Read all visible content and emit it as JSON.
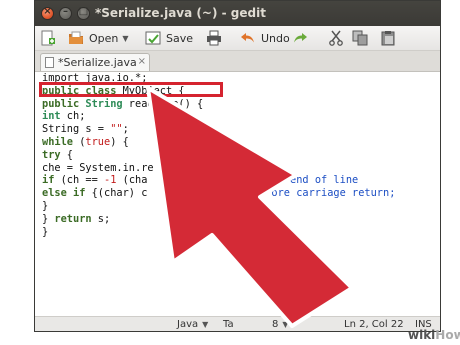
{
  "window": {
    "title": "*Serialize.java (~) - gedit",
    "controls": {
      "close": "×",
      "minimize": "–",
      "maximize": "□"
    }
  },
  "toolbar": {
    "open_label": "Open",
    "save_label": "Save",
    "undo_label": "Undo",
    "icons": [
      "new-document-icon",
      "open-folder-icon",
      "save-icon",
      "print-icon",
      "undo-icon",
      "redo-icon",
      "cut-icon",
      "copy-icon",
      "paste-icon"
    ]
  },
  "tab": {
    "label": "*Serialize.java",
    "close": "×"
  },
  "code": {
    "line1": "import java.io.*;",
    "line2_kw": "public class",
    "line2_name": " MyObject {",
    "line3_kw": "public",
    "line3_type": " String",
    "line3_rest": " readLine() {",
    "line4_type": "int",
    "line4_rest": " ch;",
    "line5_pre": "String s = ",
    "line5_str": "\"\"",
    "line5_post": ";",
    "line6_kw": "while",
    "line6_rest": " (",
    "line6_val": "true",
    "line6_post": ") {",
    "line7_kw": "try",
    "line7_rest": " {",
    "line8": "che = System.in.re",
    "line9_kw": "if",
    "line9_a": " (ch == ",
    "line9_num": "-1",
    "line9_b": " (cha",
    "line9_comment": "// end of line",
    "line10_kw": "else if",
    "line10_a": " {(char) c",
    "line10_comment": "ore carriage return;",
    "line11": "}",
    "line12_a": "} ",
    "line12_kw": "return",
    "line12_b": " s;",
    "line13": "}"
  },
  "statusbar": {
    "language": "Java",
    "tab_width": "Ta",
    "tab_width_value": "8",
    "position": "Ln 2, Col 22",
    "mode": "INS"
  },
  "watermark": {
    "wiki": "wiki",
    "how": "How"
  },
  "colors": {
    "highlight": "#d5232f",
    "arrow": "#d42a36",
    "arrow_outline": "#ffffff"
  }
}
